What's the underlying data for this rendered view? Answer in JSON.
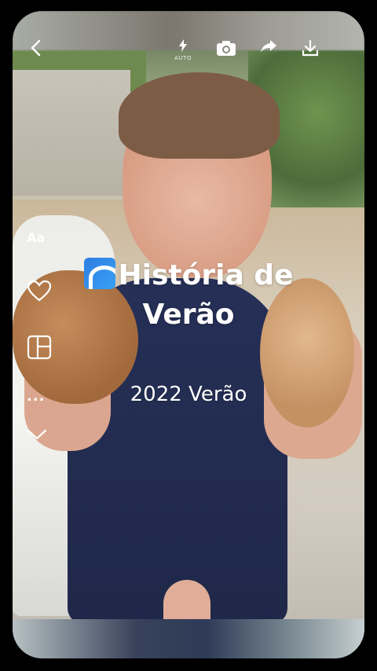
{
  "toolbar": {
    "back_icon": "chevron-left-icon",
    "flash_icon": "flash-icon",
    "flash_label": "AUTO",
    "camera_icon": "camera-icon",
    "share_icon": "share-icon",
    "download_icon": "download-icon"
  },
  "side_toolbar": {
    "text_label": "Aa",
    "like_icon": "heart-icon",
    "layout_icon": "layout-icon",
    "more_label": "...",
    "collapse_icon": "chevron-down-icon"
  },
  "story": {
    "title_line1": "História de",
    "title_line2": "Verão",
    "title_emoji": "wave-emoji",
    "subtitle": "2022 Verão"
  },
  "colors": {
    "background": "#000000",
    "overlay_text": "#ffffff",
    "wave_emoji": "#2f7de1"
  }
}
